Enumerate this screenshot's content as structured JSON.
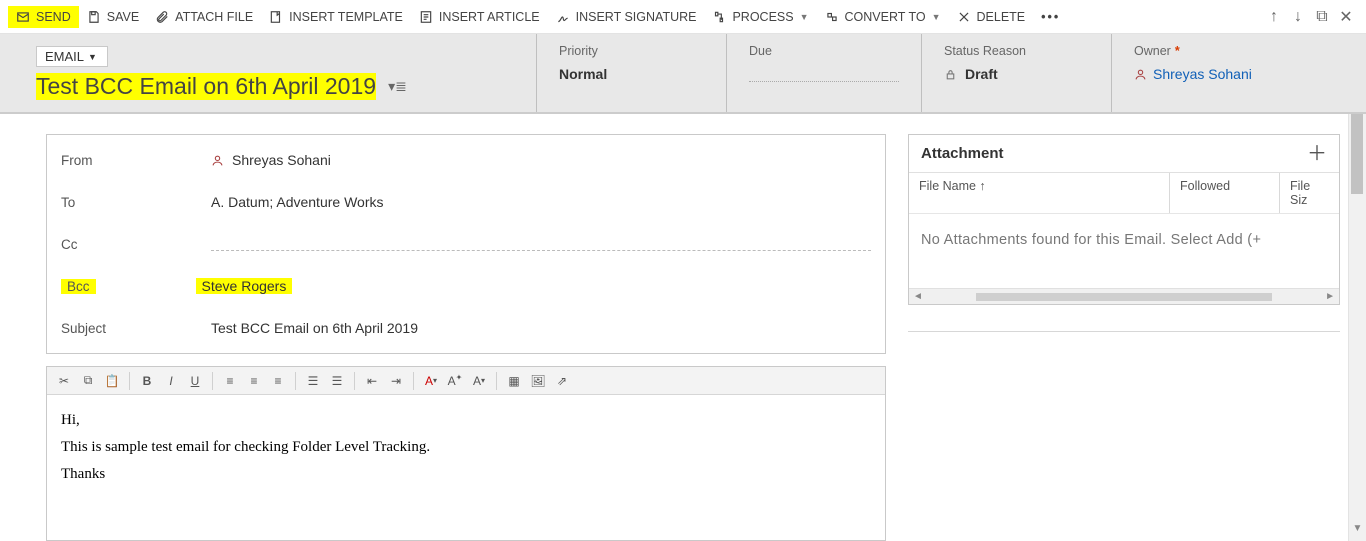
{
  "ribbon": {
    "send": "SEND",
    "save": "SAVE",
    "attach_file": "ATTACH FILE",
    "insert_template": "INSERT TEMPLATE",
    "insert_article": "INSERT ARTICLE",
    "insert_signature": "INSERT SIGNATURE",
    "process": "PROCESS",
    "convert_to": "CONVERT TO",
    "delete": "DELETE",
    "more": "•••"
  },
  "header": {
    "entity_dropdown": "EMAIL",
    "subject_title": "Test BCC Email on 6th April 2019",
    "meta": {
      "priority_label": "Priority",
      "priority_value": "Normal",
      "due_label": "Due",
      "due_value": "",
      "status_label": "Status Reason",
      "status_value": "Draft",
      "owner_label": "Owner",
      "owner_value": "Shreyas Sohani"
    }
  },
  "fields": {
    "from_label": "From",
    "from_value": "Shreyas Sohani",
    "to_label": "To",
    "to_value": "A. Datum; Adventure Works",
    "cc_label": "Cc",
    "cc_value": "",
    "bcc_label": "Bcc",
    "bcc_value": "Steve Rogers",
    "subject_label": "Subject",
    "subject_value": "Test BCC Email on 6th April 2019"
  },
  "body": {
    "line1": "Hi,",
    "line2": "This is sample test email for checking Folder Level Tracking.",
    "line3": "Thanks"
  },
  "attachments": {
    "title": "Attachment",
    "col_filename": "File Name ↑",
    "col_followed": "Followed",
    "col_filesize": "File Siz",
    "empty_msg": "No Attachments found for this Email. Select Add (+"
  }
}
